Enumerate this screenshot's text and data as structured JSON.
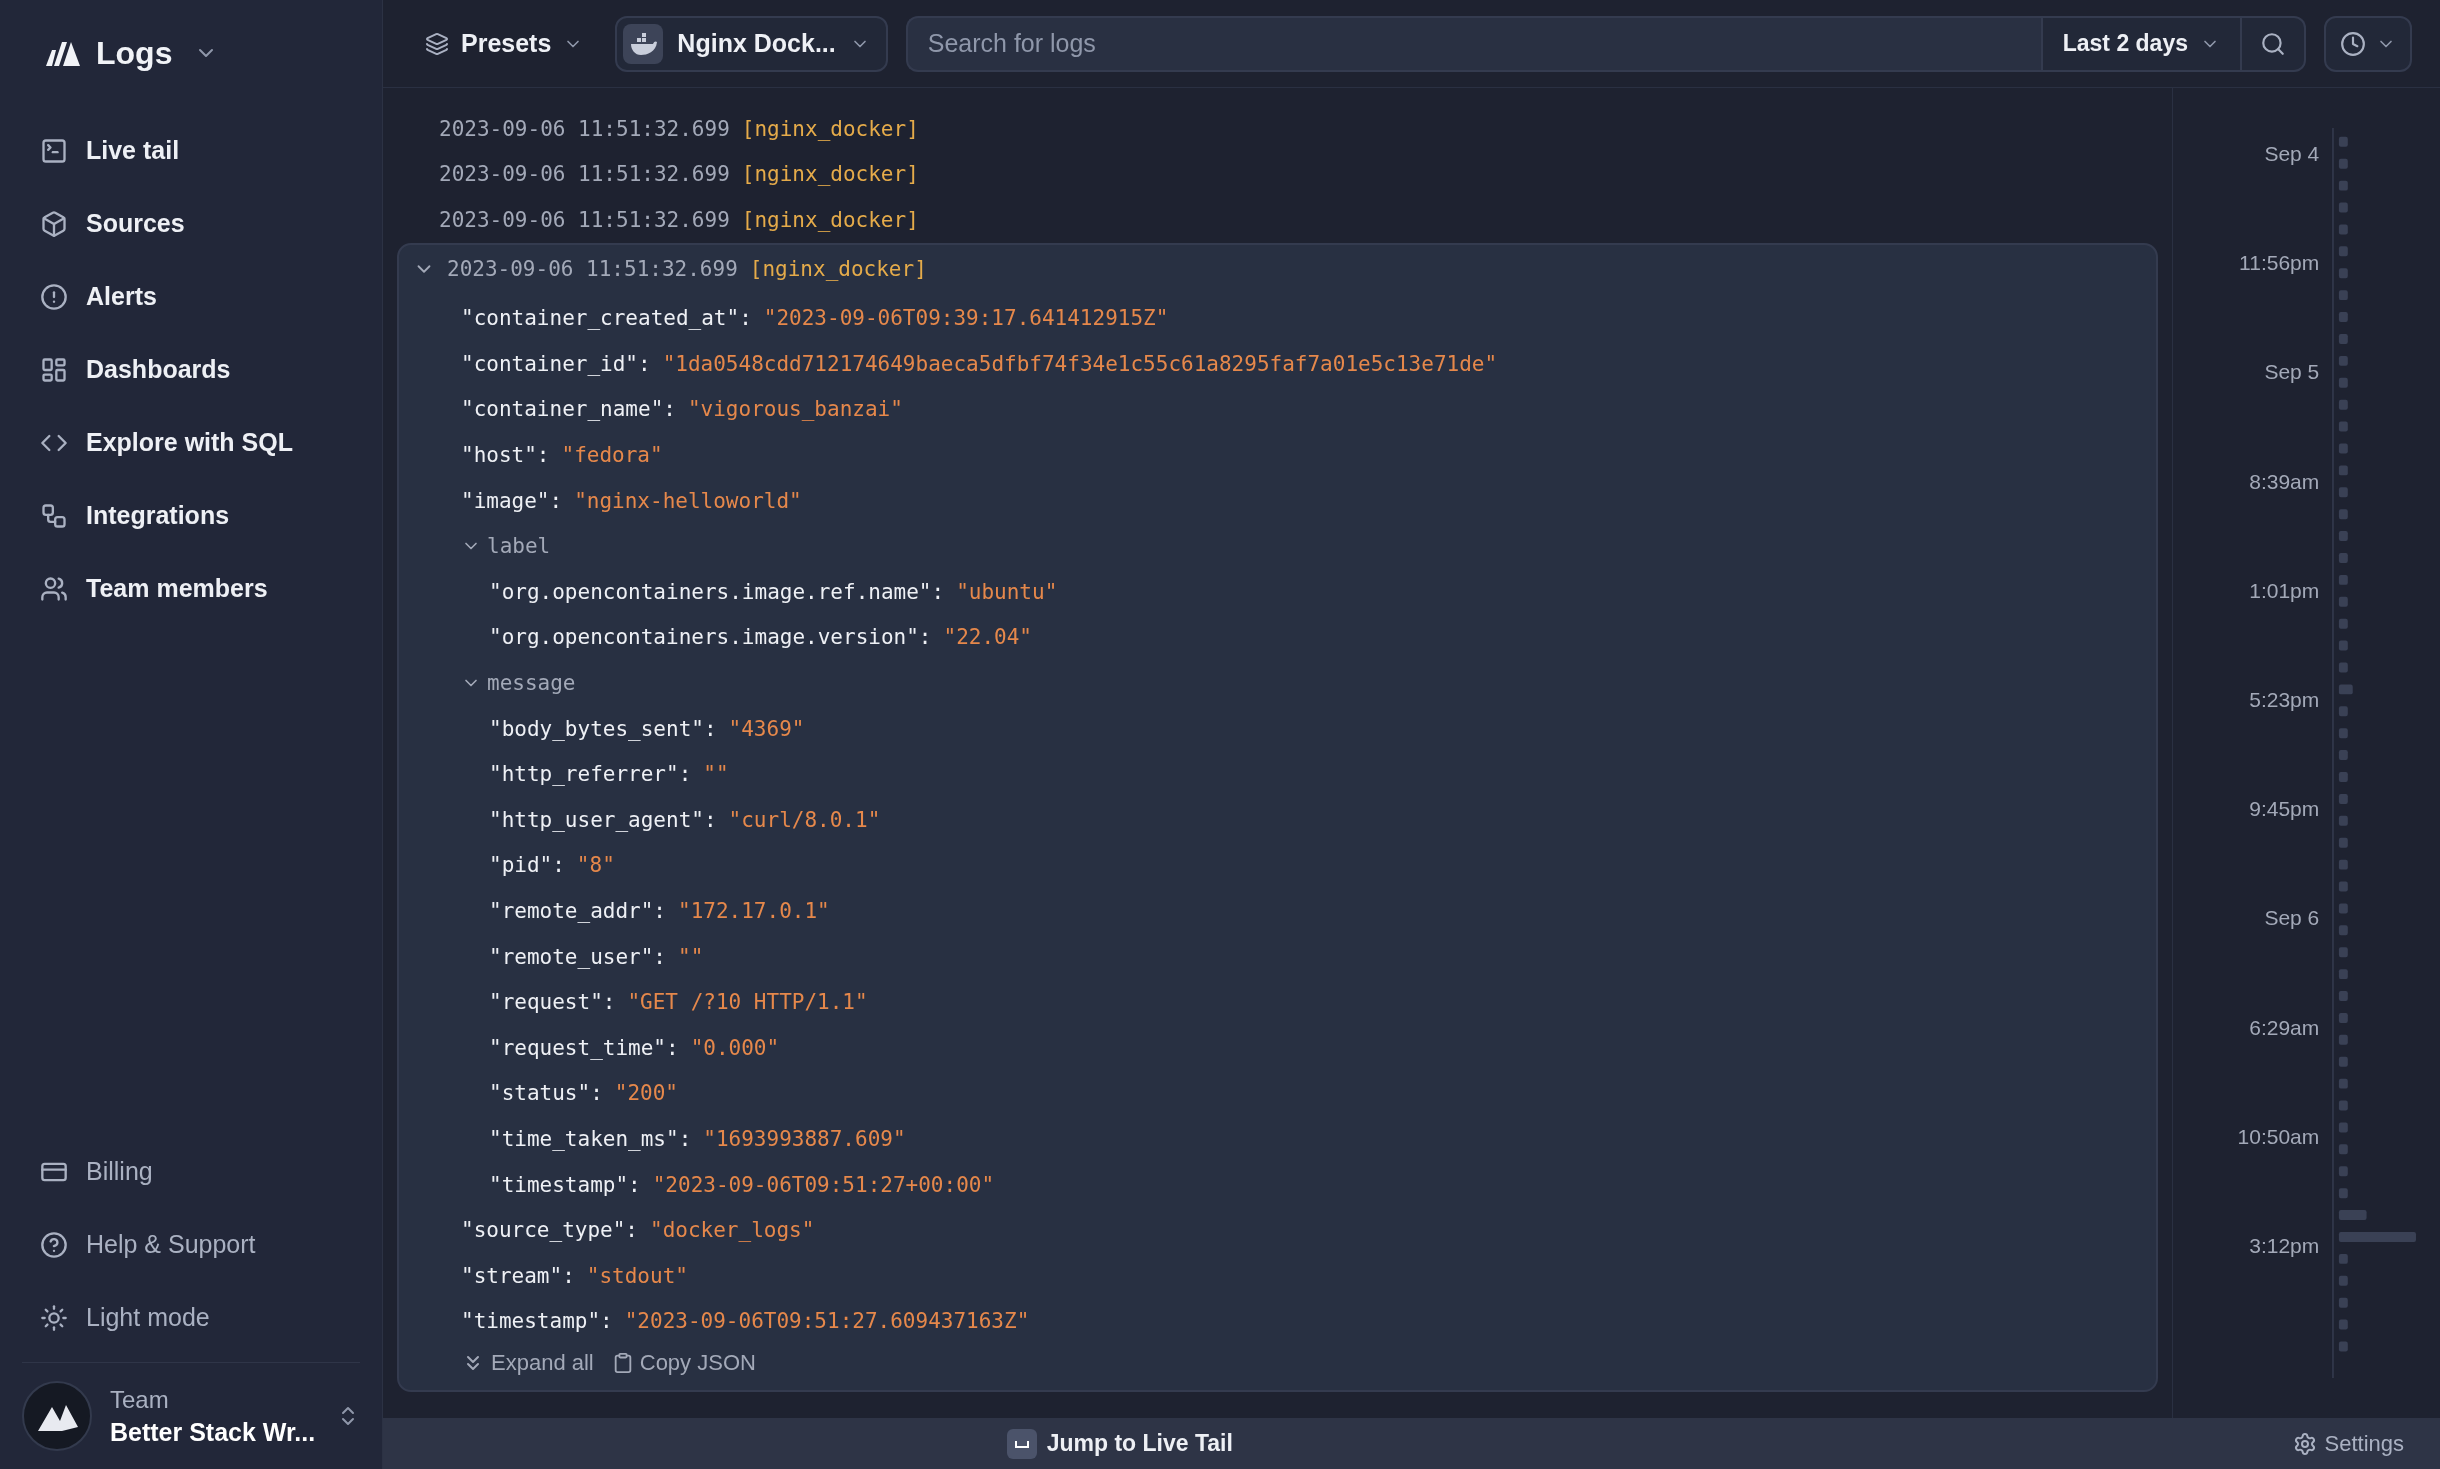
{
  "app": {
    "title": "Logs"
  },
  "nav": [
    {
      "label": "Live tail"
    },
    {
      "label": "Sources"
    },
    {
      "label": "Alerts"
    },
    {
      "label": "Dashboards"
    },
    {
      "label": "Explore with SQL"
    },
    {
      "label": "Integrations"
    },
    {
      "label": "Team members"
    }
  ],
  "nav_bottom": [
    {
      "label": "Billing"
    },
    {
      "label": "Help & Support"
    },
    {
      "label": "Light mode"
    }
  ],
  "team": {
    "caption": "Team",
    "name": "Better Stack Wr..."
  },
  "toolbar": {
    "presets": "Presets",
    "source": "Nginx Dock...",
    "search_placeholder": "Search for logs",
    "range": "Last 2 days"
  },
  "log_rows": [
    {
      "time": "2023-09-06 11:51:32.699",
      "source": "[nginx_docker]",
      "expanded": false
    },
    {
      "time": "2023-09-06 11:51:32.699",
      "source": "[nginx_docker]",
      "expanded": false
    },
    {
      "time": "2023-09-06 11:51:32.699",
      "source": "[nginx_docker]",
      "expanded": false
    },
    {
      "time": "2023-09-06 11:51:32.699",
      "source": "[nginx_docker]",
      "expanded": true,
      "fields": [
        {
          "kind": "field",
          "key": "\"container_created_at\":",
          "value": "\"2023-09-06T09:39:17.641412915Z\""
        },
        {
          "kind": "field",
          "key": "\"container_id\":",
          "value": "\"1da0548cdd712174649baeca5dfbf74f34e1c55c61a8295faf7a01e5c13e71de\""
        },
        {
          "kind": "field",
          "key": "\"container_name\":",
          "value": "\"vigorous_banzai\""
        },
        {
          "kind": "field",
          "key": "\"host\":",
          "value": "\"fedora\""
        },
        {
          "kind": "field",
          "key": "\"image\":",
          "value": "\"nginx-helloworld\""
        },
        {
          "kind": "group",
          "key": "label",
          "expanded": true,
          "children": [
            {
              "kind": "field",
              "key": "\"org.opencontainers.image.ref.name\":",
              "value": "\"ubuntu\""
            },
            {
              "kind": "field",
              "key": "\"org.opencontainers.image.version\":",
              "value": "\"22.04\""
            }
          ]
        },
        {
          "kind": "group",
          "key": "message",
          "expanded": true,
          "children": [
            {
              "kind": "field",
              "key": "\"body_bytes_sent\":",
              "value": "\"4369\""
            },
            {
              "kind": "field",
              "key": "\"http_referrer\":",
              "value": "\"\""
            },
            {
              "kind": "field",
              "key": "\"http_user_agent\":",
              "value": "\"curl/8.0.1\""
            },
            {
              "kind": "field",
              "key": "\"pid\":",
              "value": "\"8\""
            },
            {
              "kind": "field",
              "key": "\"remote_addr\":",
              "value": "\"172.17.0.1\""
            },
            {
              "kind": "field",
              "key": "\"remote_user\":",
              "value": "\"\""
            },
            {
              "kind": "field",
              "key": "\"request\":",
              "value": "\"GET /?10 HTTP/1.1\""
            },
            {
              "kind": "field",
              "key": "\"request_time\":",
              "value": "\"0.000\""
            },
            {
              "kind": "field",
              "key": "\"status\":",
              "value": "\"200\""
            },
            {
              "kind": "field",
              "key": "\"time_taken_ms\":",
              "value": "\"1693993887.609\""
            },
            {
              "kind": "field",
              "key": "\"timestamp\":",
              "value": "\"2023-09-06T09:51:27+00:00\""
            }
          ]
        },
        {
          "kind": "field",
          "key": "\"source_type\":",
          "value": "\"docker_logs\""
        },
        {
          "kind": "field",
          "key": "\"stream\":",
          "value": "\"stdout\""
        },
        {
          "kind": "field",
          "key": "\"timestamp\":",
          "value": "\"2023-09-06T09:51:27.609437163Z\""
        }
      ],
      "actions": [
        "Expand all",
        "Copy JSON"
      ]
    }
  ],
  "timeline": [
    "Sep 4",
    "11:56pm",
    "Sep 5",
    "8:39am",
    "1:01pm",
    "5:23pm",
    "9:45pm",
    "Sep 6",
    "6:29am",
    "10:50am",
    "3:12pm"
  ],
  "footer": {
    "jump": "Jump to Live Tail",
    "settings": "Settings"
  }
}
